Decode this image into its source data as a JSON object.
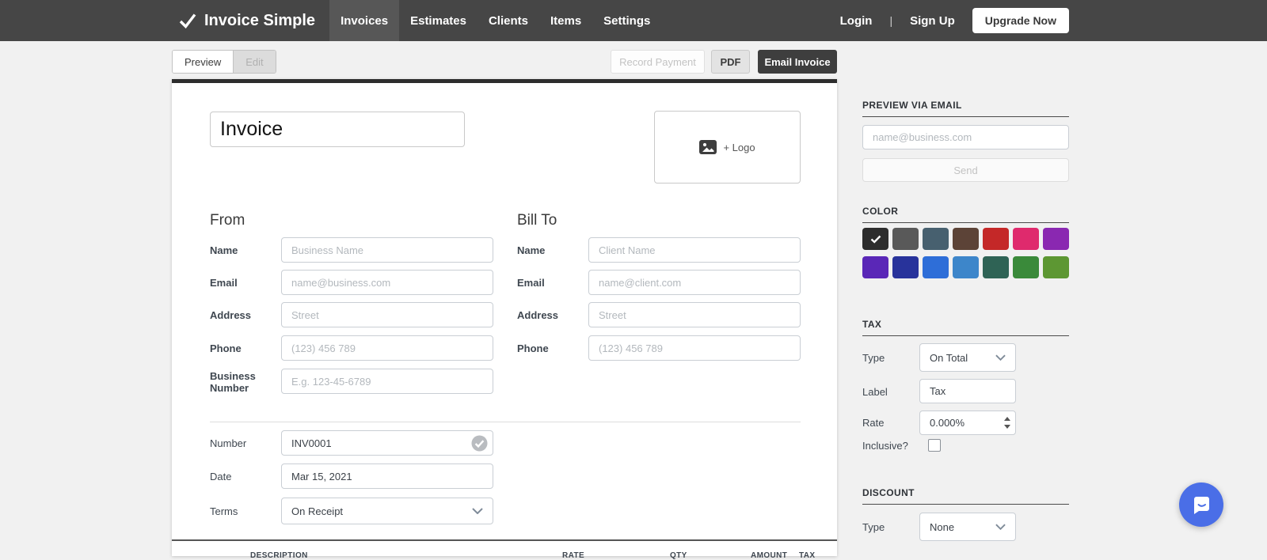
{
  "nav": {
    "brand": "Invoice Simple",
    "items": [
      {
        "label": "Invoices",
        "active": true
      },
      {
        "label": "Estimates",
        "active": false
      },
      {
        "label": "Clients",
        "active": false
      },
      {
        "label": "Items",
        "active": false
      },
      {
        "label": "Settings",
        "active": false
      }
    ],
    "login": "Login",
    "separator": "|",
    "signup": "Sign Up",
    "upgrade": "Upgrade Now"
  },
  "toolbar": {
    "preview": "Preview",
    "edit": "Edit",
    "record_payment": "Record Payment",
    "pdf": "PDF",
    "email_invoice": "Email Invoice"
  },
  "invoice": {
    "title": "Invoice",
    "logo_label": "+ Logo",
    "from": {
      "heading": "From",
      "fields": [
        {
          "label": "Name",
          "placeholder": "Business Name"
        },
        {
          "label": "Email",
          "placeholder": "name@business.com"
        },
        {
          "label": "Address",
          "placeholder": "Street"
        },
        {
          "label": "Phone",
          "placeholder": "(123) 456 789"
        },
        {
          "label": "Business Number",
          "placeholder": "E.g. 123-45-6789"
        }
      ]
    },
    "bill_to": {
      "heading": "Bill To",
      "fields": [
        {
          "label": "Name",
          "placeholder": "Client Name"
        },
        {
          "label": "Email",
          "placeholder": "name@client.com"
        },
        {
          "label": "Address",
          "placeholder": "Street"
        },
        {
          "label": "Phone",
          "placeholder": "(123) 456 789"
        }
      ]
    },
    "meta": {
      "number_label": "Number",
      "number_value": "INV0001",
      "date_label": "Date",
      "date_value": "Mar 15, 2021",
      "terms_label": "Terms",
      "terms_value": "On Receipt"
    },
    "items_table": {
      "headers": [
        "DESCRIPTION",
        "RATE",
        "QTY",
        "AMOUNT",
        "TAX"
      ]
    }
  },
  "sidebar": {
    "preview_via_email": {
      "heading": "PREVIEW VIA EMAIL",
      "email_placeholder": "name@business.com",
      "send": "Send"
    },
    "color": {
      "heading": "COLOR",
      "selected_index": 0,
      "swatches": [
        "#2d2d2d",
        "#595959",
        "#47606f",
        "#5c4337",
        "#c42828",
        "#df2a6d",
        "#8a28b1",
        "#5a27b7",
        "#28339b",
        "#2e6ed8",
        "#3d86ca",
        "#2f6355",
        "#3a8a3a",
        "#5d9733"
      ]
    },
    "tax": {
      "heading": "TAX",
      "type_label": "Type",
      "type_value": "On Total",
      "label_label": "Label",
      "label_value": "Tax",
      "rate_label": "Rate",
      "rate_value": "0.000%",
      "inclusive_label": "Inclusive?",
      "inclusive_checked": false
    },
    "discount": {
      "heading": "DISCOUNT",
      "type_label": "Type",
      "type_value": "None"
    }
  },
  "colors": {
    "chat_bubble": "#4a6ee7",
    "nav_background": "#464646",
    "card_accent_top": "#2d2d2d"
  }
}
